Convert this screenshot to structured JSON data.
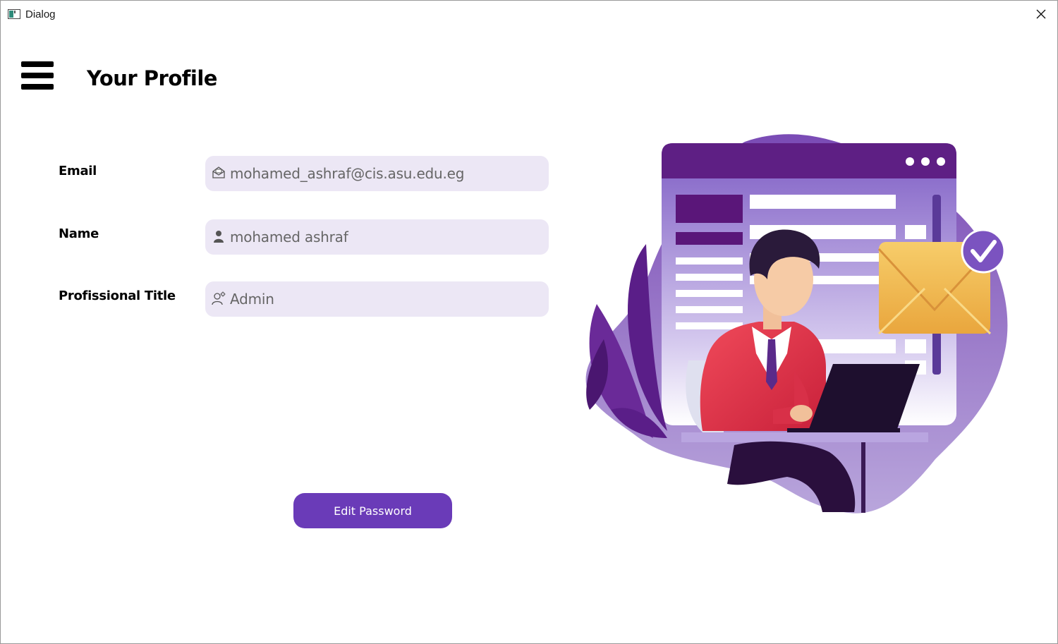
{
  "window": {
    "title": "Dialog",
    "app_icon": "window-app-icon",
    "close_icon": "close-icon"
  },
  "header": {
    "menu_icon": "hamburger-menu-icon",
    "title": "Your Profile"
  },
  "form": {
    "email": {
      "label": "Email",
      "value": "mohamed_ashraf@cis.asu.edu.eg",
      "icon": "envelope-icon"
    },
    "name": {
      "label": "Name",
      "value": "mohamed ashraf",
      "icon": "user-icon"
    },
    "title": {
      "label": "Profissional Title",
      "value": "Admin",
      "icon": "user-gear-icon"
    }
  },
  "actions": {
    "edit_password_label": "Edit Password"
  },
  "colors": {
    "accent": "#6a3bb8",
    "field_bg": "#ece7f5",
    "illustration_purple": "#6b2d8f",
    "envelope_gold": "#f2b84b"
  }
}
